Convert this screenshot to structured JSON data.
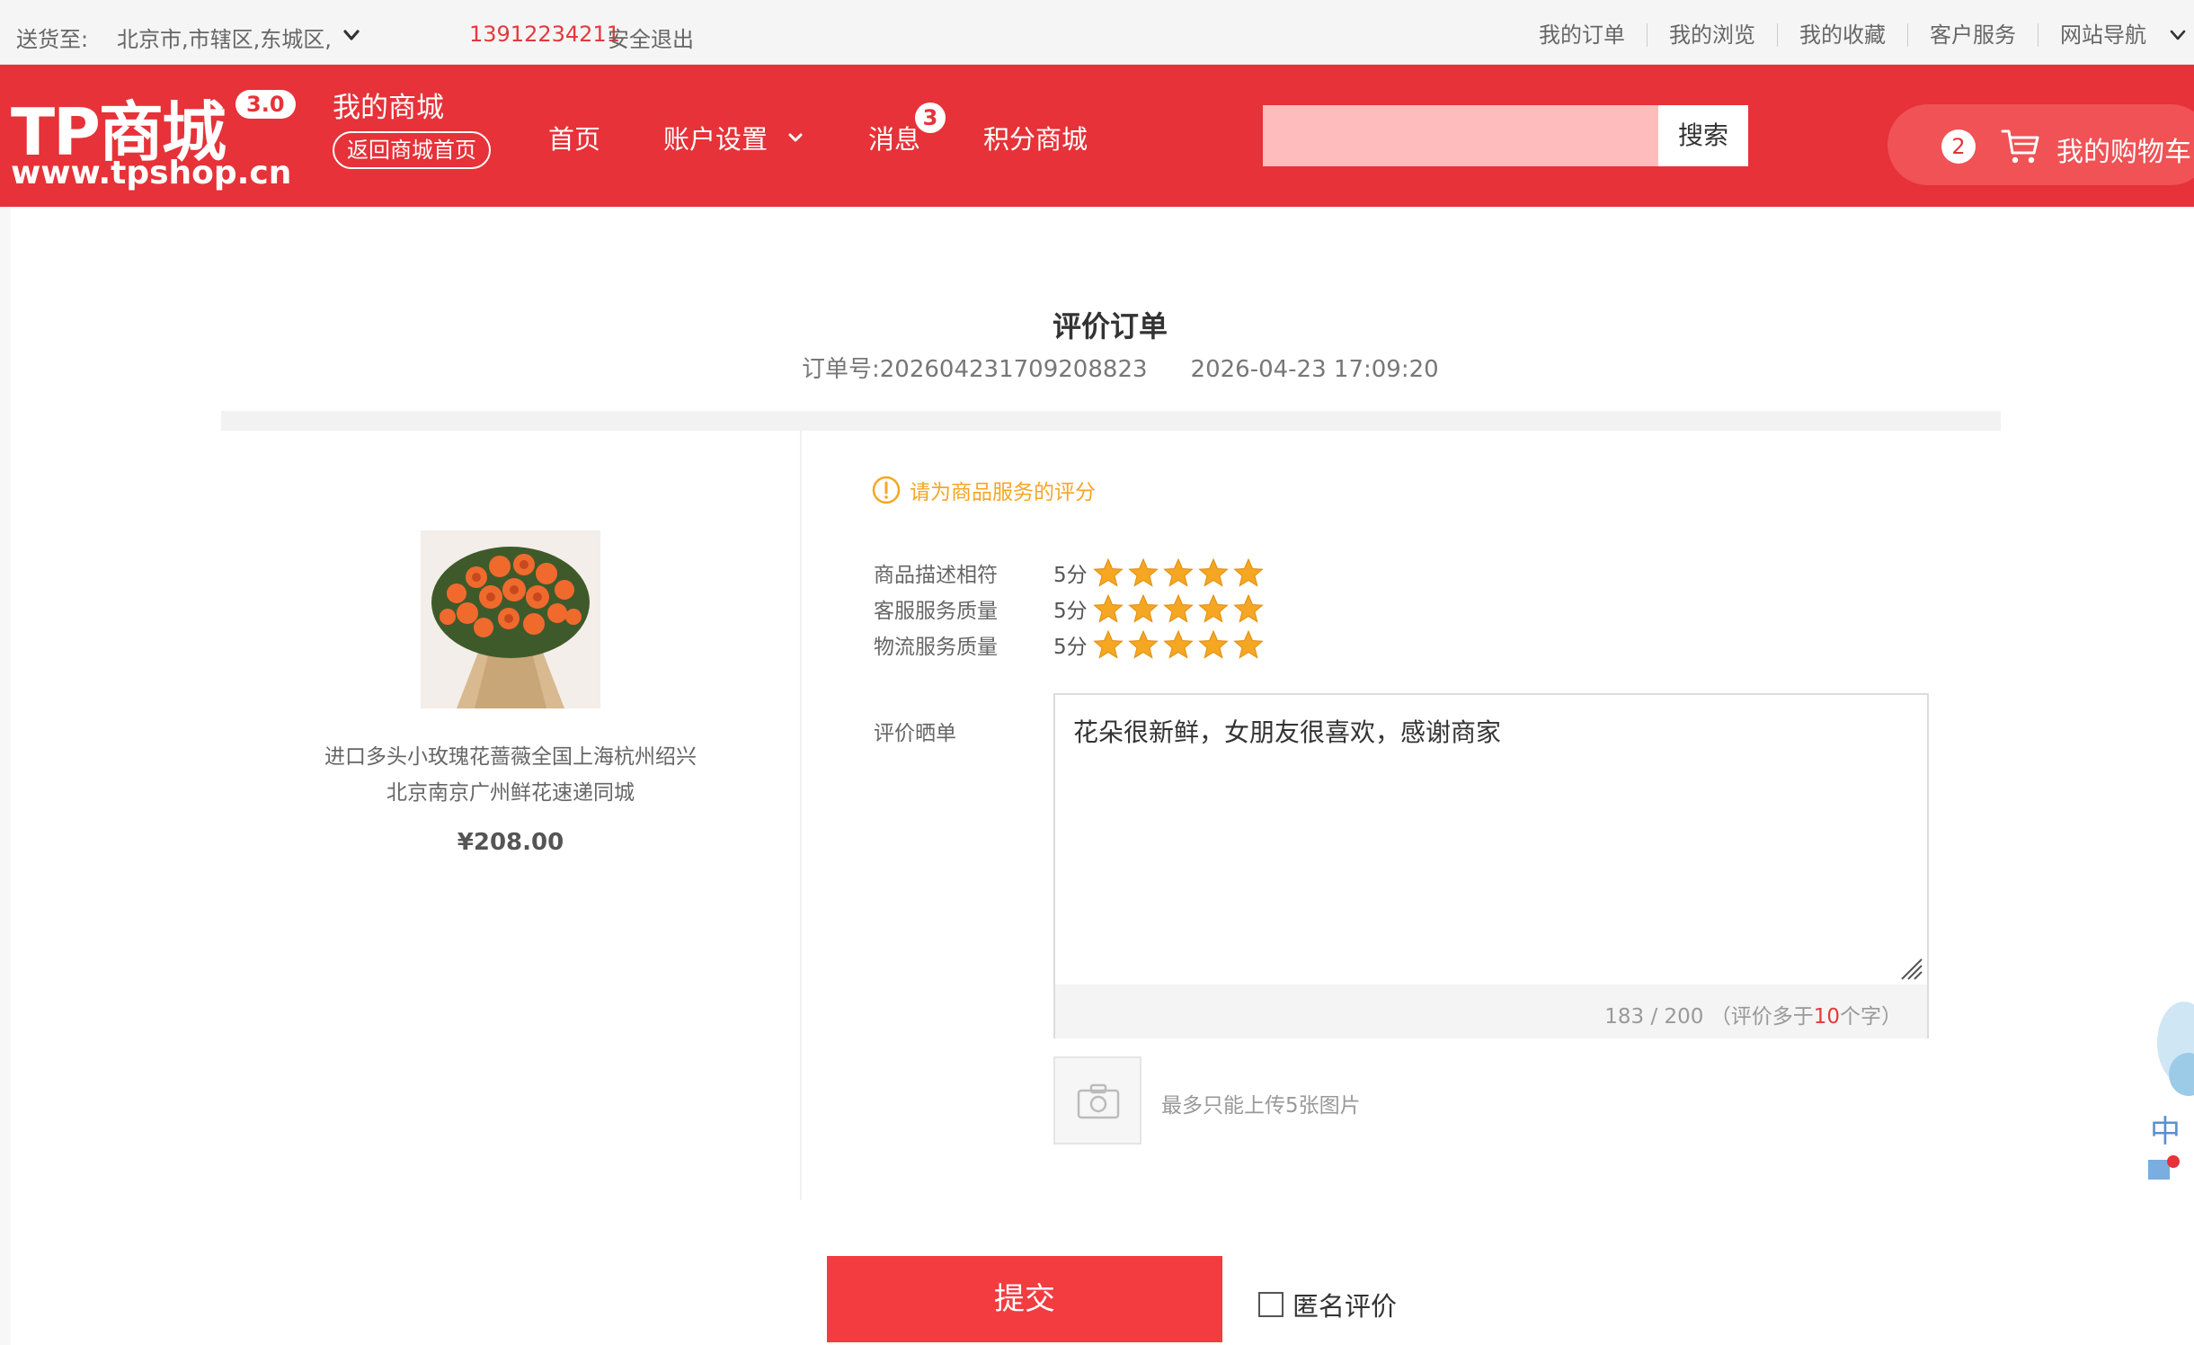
{
  "topbar": {
    "deliver_label": "送货至:",
    "deliver_value": "北京市,市辖区,东城区,",
    "phone": "13912234211",
    "logout": "安全退出",
    "links": [
      "我的订单",
      "我的浏览",
      "我的收藏",
      "客户服务",
      "网站导航"
    ]
  },
  "header": {
    "brand": "TP商城",
    "version": "3.0",
    "url": "www.tpshop.cn",
    "my_mall": "我的商城",
    "back_home": "返回商城首页",
    "nav": {
      "home": "首页",
      "account": "账户设置",
      "messages": "消息",
      "messages_badge": "3",
      "points_mall": "积分商城"
    },
    "search": {
      "value": "",
      "button": "搜索"
    },
    "cart": {
      "count": "2",
      "label": "我的购物车"
    }
  },
  "page": {
    "title": "评价订单",
    "order_label": "订单号:",
    "order_no": "202604231709208823",
    "order_date": "2026-04-23 17:09:20"
  },
  "product": {
    "name_line1": "进口多头小玫瑰花蔷薇全国上海杭州绍兴",
    "name_line2": "北京南京广州鲜花速递同城",
    "price": "¥208.00"
  },
  "rating": {
    "tip": "请为商品服务的评分",
    "rows": [
      {
        "label": "商品描述相符",
        "score": "5分",
        "stars": 5
      },
      {
        "label": "客服服务质量",
        "score": "5分",
        "stars": 5
      },
      {
        "label": "物流服务质量",
        "score": "5分",
        "stars": 5
      }
    ]
  },
  "review": {
    "label": "评价晒单",
    "text": "花朵很新鲜，女朋友很喜欢，感谢商家",
    "count_prefix": "183 / 200 （评价多于",
    "count_min": "10",
    "count_suffix": "个字）",
    "upload_tip": "最多只能上传5张图片"
  },
  "actions": {
    "submit": "提交",
    "anonymous": "匿名评价"
  },
  "colors": {
    "brand_red": "#e63238",
    "star": "#f5a623",
    "tip": "#f5a623"
  }
}
